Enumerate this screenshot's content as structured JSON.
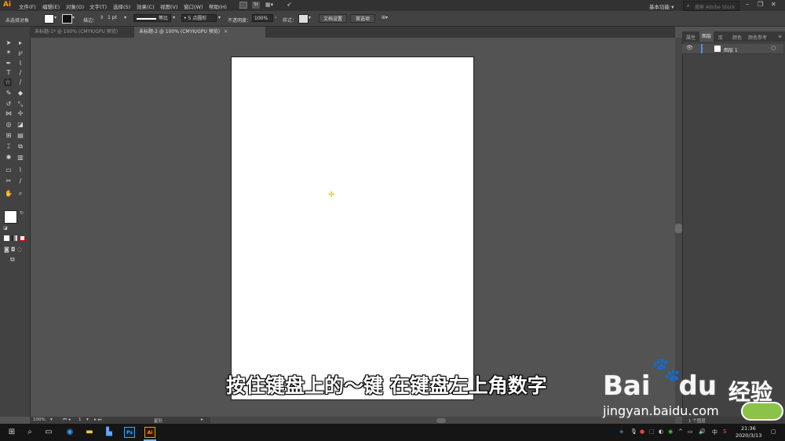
{
  "app": {
    "logo": "Ai"
  },
  "menu": [
    "文件(F)",
    "编辑(E)",
    "对象(O)",
    "文字(T)",
    "选择(S)",
    "效果(C)",
    "视图(V)",
    "窗口(W)",
    "帮助(H)"
  ],
  "menubar": {
    "st_badge": "St",
    "workspace": "基本功能",
    "search_placeholder": "搜索 Adobe Stock"
  },
  "controlbar": {
    "selection": "未选择对象",
    "stroke_label": "描边：",
    "stroke_value": "1 pt",
    "stroke_style": "等比",
    "brush": "5 点圆形",
    "opacity_label": "不透明度：",
    "opacity_value": "100%",
    "style_label": "样式：",
    "doc_setup": "文档设置",
    "preferences": "首选项"
  },
  "tabs": [
    {
      "label": "未标题-1* @ 100% (CMYK/GPU 预览)",
      "active": false
    },
    {
      "label": "未标题-2 @ 100% (CMYK/GPU 预览)",
      "active": true
    }
  ],
  "statusbar": {
    "zoom": "100%",
    "artboard_num": "1",
    "tool": "星形"
  },
  "panel": {
    "tabs": [
      "属性",
      "图层",
      "库",
      "颜色",
      "颜色参考"
    ],
    "layer_name": "图层 1",
    "footer": "1 个图层"
  },
  "subtitle": "按住键盘上的～键 在键盘左上角数字",
  "watermark": {
    "logo": "Bai",
    "logo_suffix": "du",
    "jingyan": "经验",
    "url": "jingyan.baidu.com"
  },
  "clock": {
    "time": "21:36",
    "date": "2020/3/13"
  },
  "tray": {
    "ime": "中",
    "ime2": "S"
  },
  "taskbar_apps": {
    "ps": "Ps",
    "ai": "Ai"
  },
  "colors": {
    "accent": "#ff9a00",
    "layer_select": "#4b8ef2",
    "bg": "#535353"
  }
}
